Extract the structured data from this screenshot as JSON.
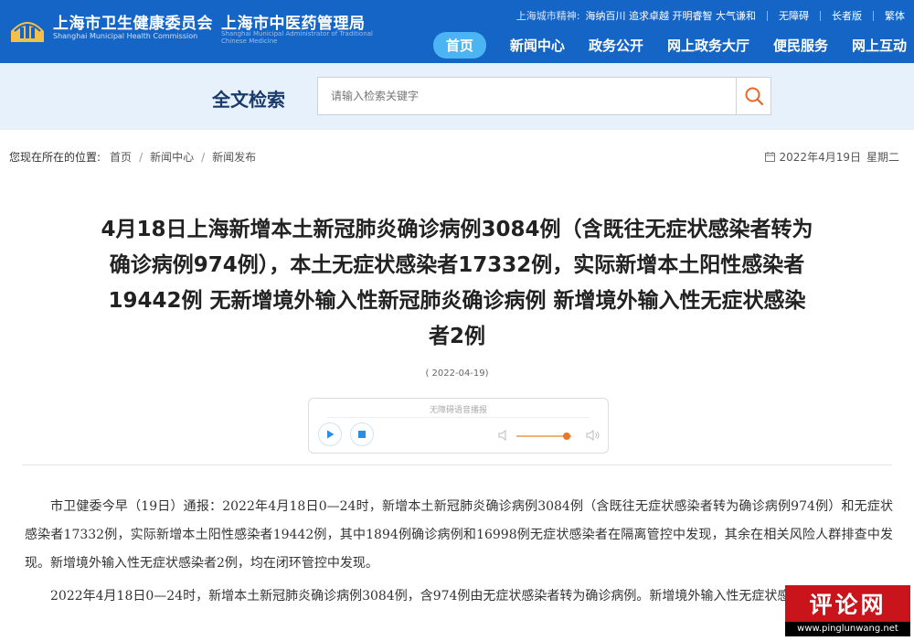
{
  "header": {
    "org1": "上海市卫生健康委员会",
    "org1_en": "Shanghai Municipal Health Commission",
    "org2": "上海市中医药管理局",
    "org2_en": "Shanghai Municipal Administrator of Traditional Chinese Medicine",
    "spirit_label": "上海城市精神:",
    "spirit": "海纳百川 追求卓越 开明睿智 大气谦和",
    "accessibility": "无障碍",
    "elder": "长者版",
    "traditional": "繁体",
    "nav": [
      "首页",
      "新闻中心",
      "政务公开",
      "网上政务大厅",
      "便民服务",
      "网上互动"
    ],
    "brand_color": "#1565c7"
  },
  "search": {
    "title": "全文检索",
    "placeholder": "请输入检索关键字",
    "button_icon": "search-icon"
  },
  "breadcrumb": {
    "label": "您现在所在的位置:",
    "items": [
      "首页",
      "新闻中心",
      "新闻发布"
    ]
  },
  "date_info": {
    "date": "2022年4月19日",
    "weekday": "星期二"
  },
  "article": {
    "title": "4月18日上海新增本土新冠肺炎确诊病例3084例（含既往无症状感染者转为确诊病例974例），本土无症状感染者17332例，实际新增本土阳性感染者19442例 无新增境外输入性新冠肺炎确诊病例 新增境外输入性无症状感染者2例",
    "pub_date": "( 2022-04-19)",
    "player_label": "无障碍语音播报",
    "player_volume": 0.85,
    "paragraphs": [
      "市卫健委今早（19日）通报：2022年4月18日0—24时，新增本土新冠肺炎确诊病例3084例（含既往无症状感染者转为确诊病例974例）和无症状感染者17332例，实际新增本土阳性感染者19442例，其中1894例确诊病例和16998例无症状感染者在隔离管控中发现，其余在相关风险人群排查中发现。新增境外输入性无症状感染者2例，均在闭环管控中发现。",
      "2022年4月18日0—24时，新增本土新冠肺炎确诊病例3084例，含974例由无症状感染者转为确诊病例。新增境外输入性无症状感染者2例。"
    ]
  },
  "watermark": {
    "big": "评论网",
    "small": "www.pinglunwang.net"
  }
}
